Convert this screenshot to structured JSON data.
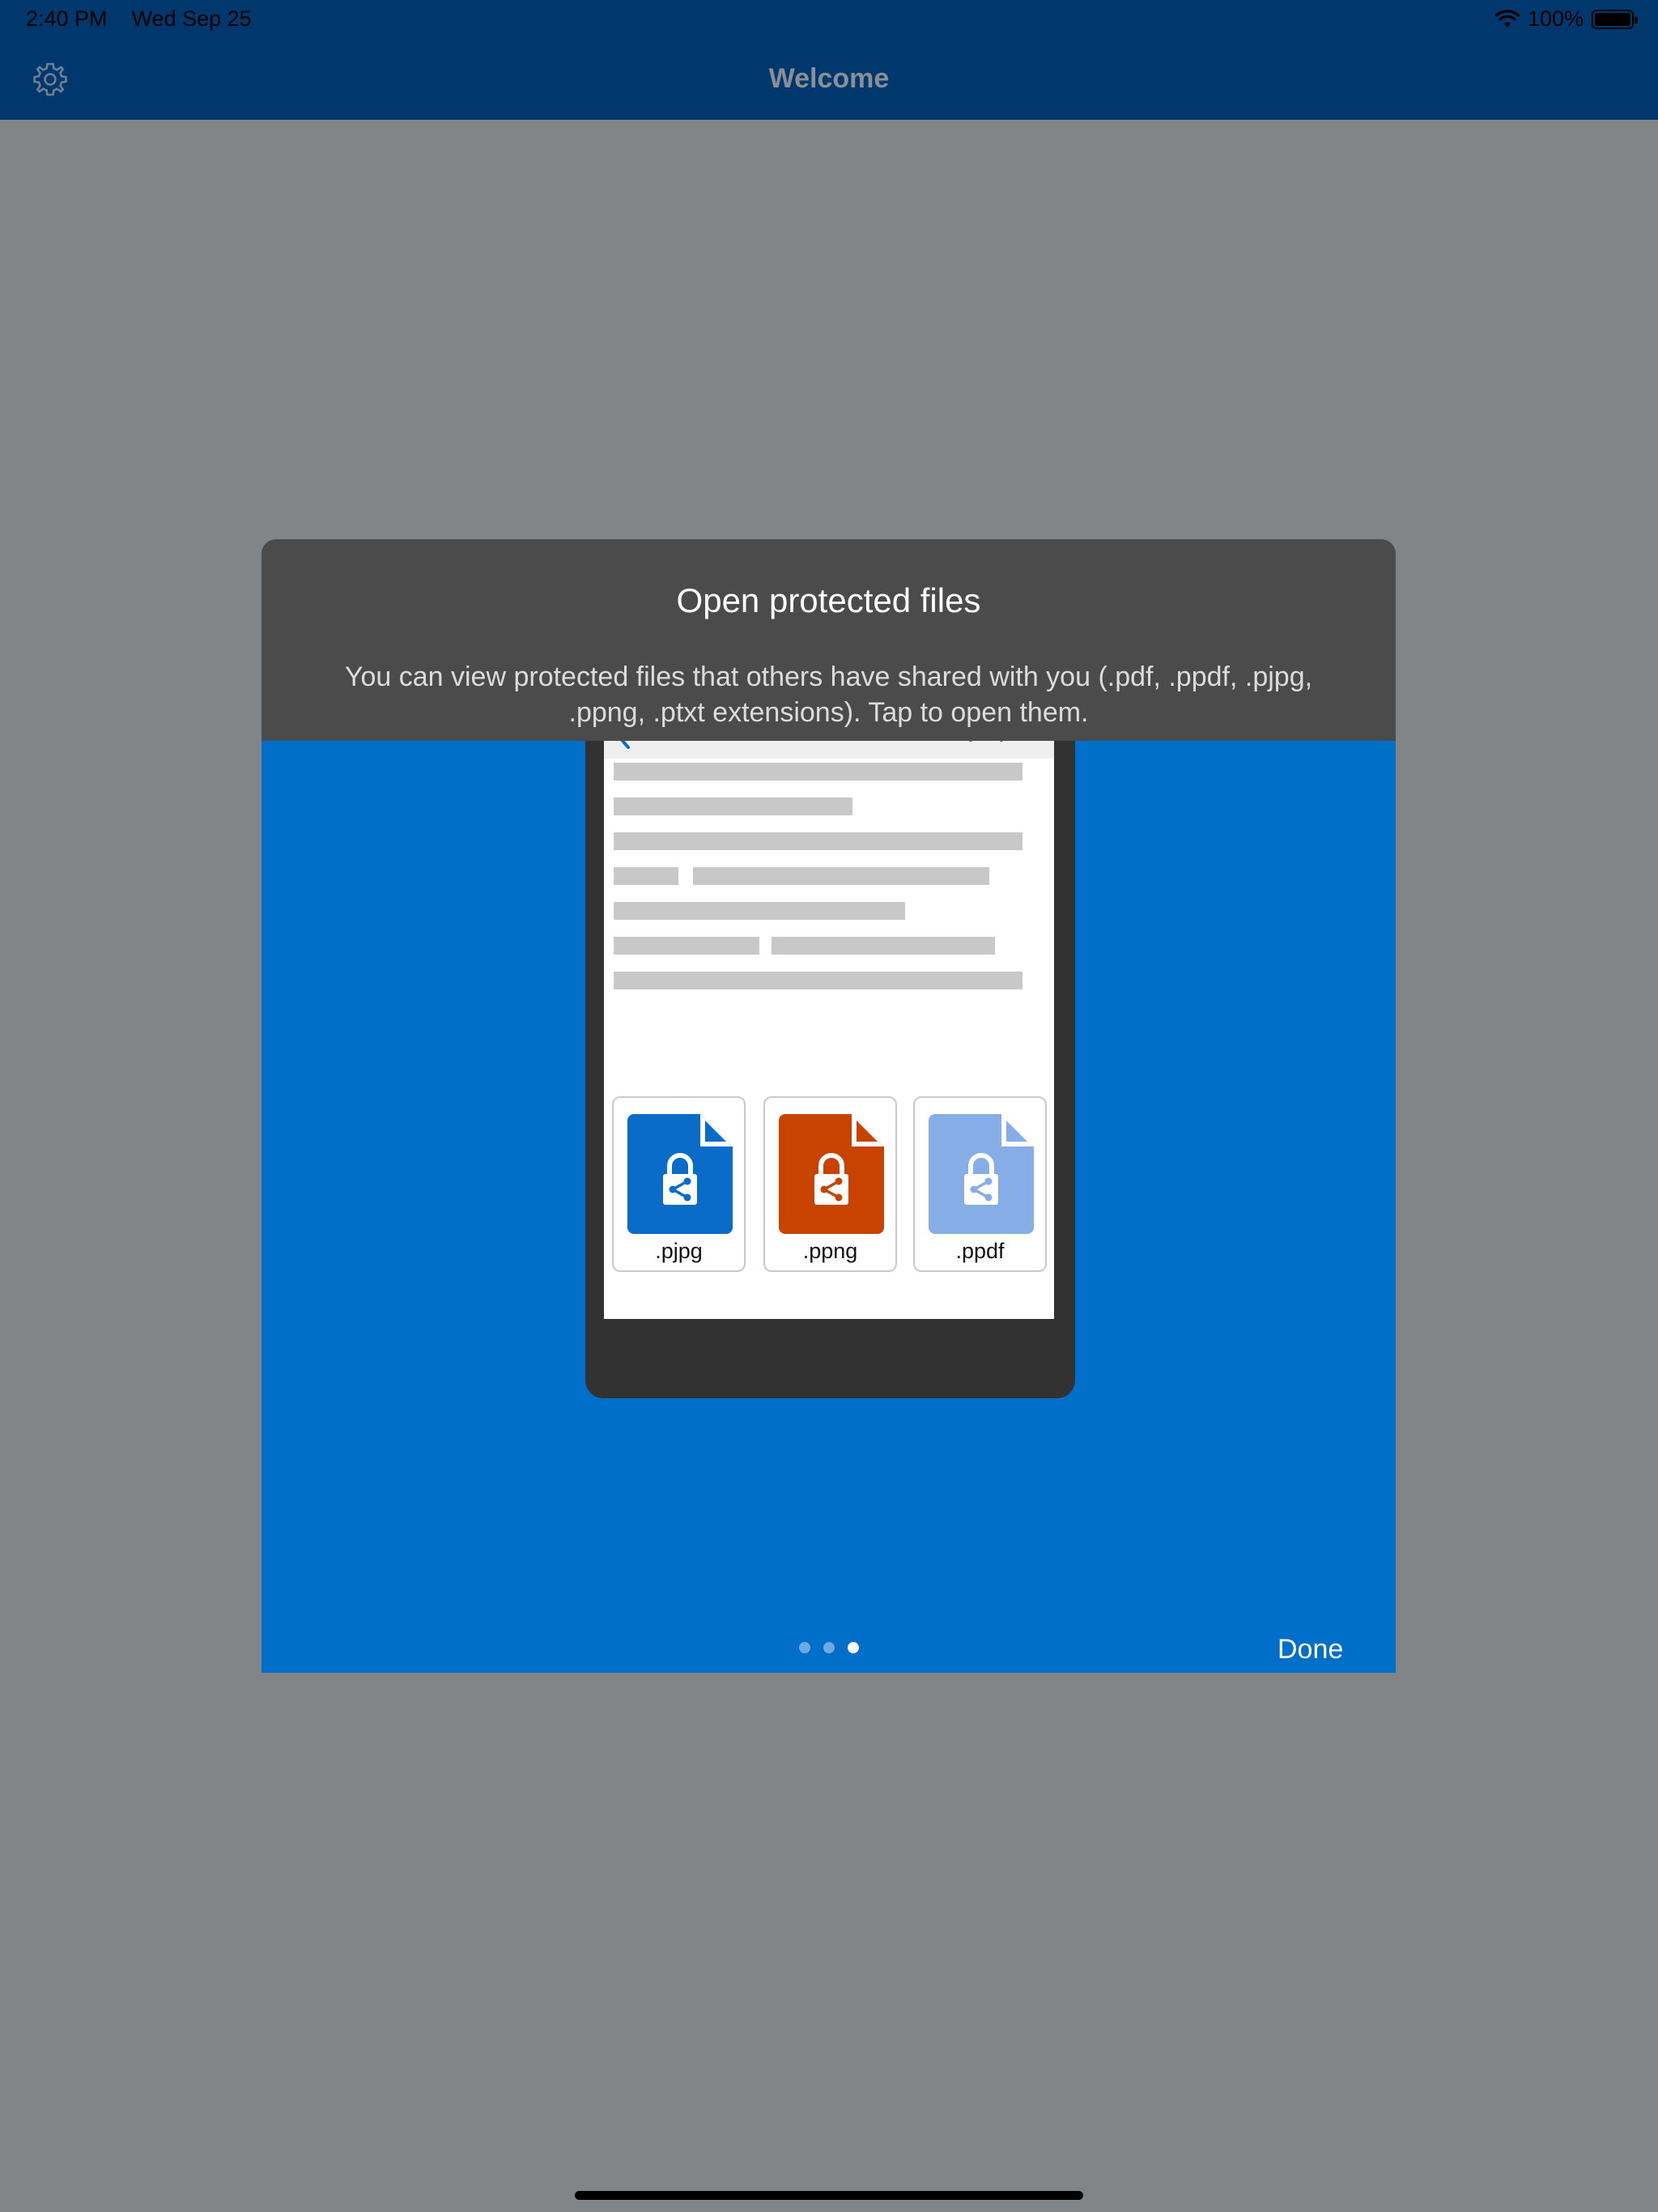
{
  "status_bar": {
    "time": "2:40 PM",
    "date": "Wed Sep 25",
    "battery": "100%"
  },
  "nav": {
    "title": "Welcome",
    "settings_icon": "gear-icon"
  },
  "modal": {
    "title": "Open protected files",
    "description": "You can view protected files that others have shared with you (.pdf, .ppdf, .pjpg, .ppng, .ptxt extensions). Tap to open them.",
    "files": [
      {
        "label": ".pjpg",
        "color": "#0a6cc9"
      },
      {
        "label": ".ppng",
        "color": "#c84300"
      },
      {
        "label": ".ppdf",
        "color": "#86ade6"
      }
    ],
    "page_count": 3,
    "active_page": 3,
    "done_label": "Done"
  },
  "colors": {
    "accent": "#006fca",
    "navbar": "#00386d",
    "header": "#4b4b4b"
  }
}
